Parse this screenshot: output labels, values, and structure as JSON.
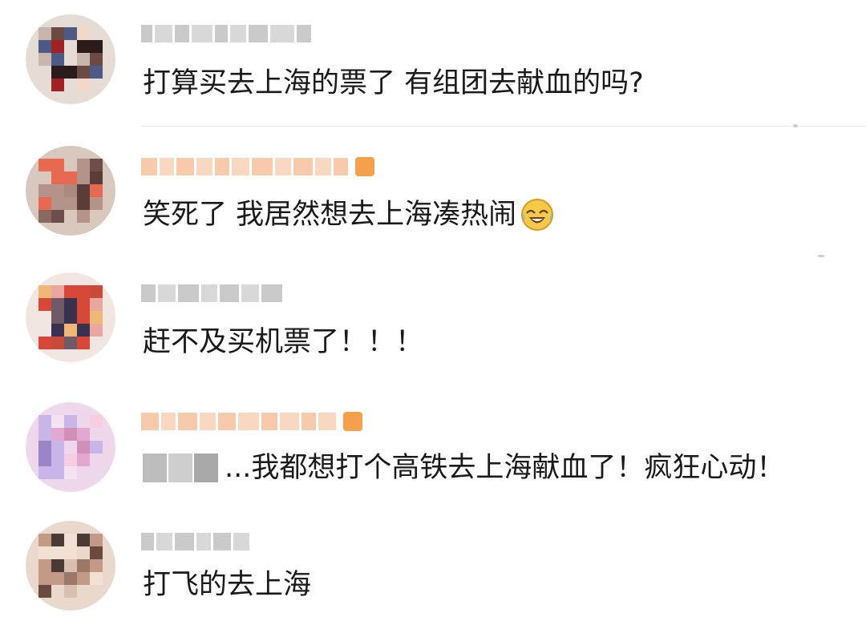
{
  "comments": [
    {
      "text": "打算买去上海的票了 有组团去献血的吗?",
      "username_blurred": true,
      "name_color": "#b8b8b8",
      "avatar_palette": [
        "#e6dcd6",
        "#a02222",
        "#2a1a1a",
        "#f3d8c8",
        "#6b4a44",
        "#c9b5ad",
        "#4d5a86"
      ]
    },
    {
      "text": "笑死了 我居然想去上海凑热闹",
      "emoji": "laugh-cry-emoji",
      "username_blurred": true,
      "name_color": "#f3b88d",
      "vip_badge": true,
      "avatar_palette": [
        "#d8c8be",
        "#8a6a60",
        "#b4948a",
        "#5a3c38",
        "#e86a50",
        "#a88a80",
        "#6d4e4a"
      ]
    },
    {
      "text": "赶不及买机票了！！！",
      "username_blurred": true,
      "name_color": "#b8b8b8",
      "avatar_palette": [
        "#f2e6e2",
        "#d84838",
        "#3a3050",
        "#f0b878",
        "#c84a3a",
        "#e9a7a0",
        "#705a68"
      ]
    },
    {
      "text": "...我都想打个高铁去上海献血了！疯狂心动！",
      "mention_blurred": true,
      "username_blurred": true,
      "name_color": "#f3b88d",
      "vip_badge": true,
      "avatar_palette": [
        "#efd8ec",
        "#e3a8d2",
        "#c9b6e8",
        "#f7cde0",
        "#9a86c6",
        "#f3e2f2",
        "#d28fb8"
      ]
    },
    {
      "text": "打飞的去上海",
      "username_blurred": true,
      "name_color": "#b8b8b8",
      "avatar_palette": [
        "#ead8cc",
        "#c29a86",
        "#6a4a40",
        "#f1e0d4",
        "#9b7868",
        "#d9bfb2",
        "#4a3a36"
      ]
    }
  ]
}
